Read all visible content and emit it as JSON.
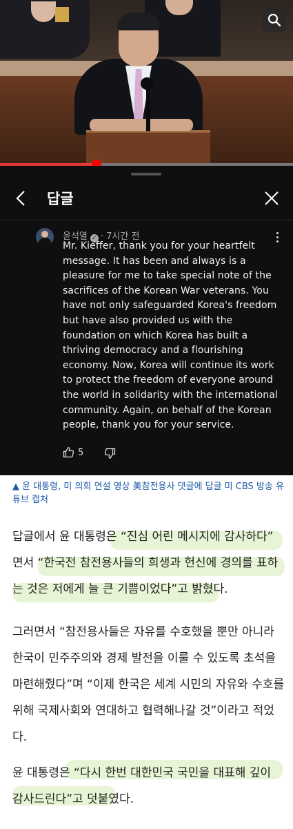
{
  "video": {
    "search_icon": "search-icon",
    "progress_percent": 33
  },
  "panel": {
    "title": "답글",
    "back_icon": "chevron-left-icon",
    "close_icon": "close-icon"
  },
  "comment": {
    "author": "윤석열",
    "verified_icon": "verified-check-icon",
    "time": "· 7시간 전",
    "text": "Mr. Kieffer, thank you for your heartfelt message. It has been and always is a pleasure for me to take special note of the sacrifices of the Korean War veterans. You have not only safeguarded Korea's freedom but have also provided us with the foundation on which Korea has built a thriving democracy and a flourishing economy. Now, Korea will continue its work to protect the freedom of everyone around the world in solidarity with the international community. Again, on behalf of the Korean people, thank you for your service.",
    "likes": "5"
  },
  "caption": "▲ 윤 대통령, 미 의회 연설 영상 美참전용사 댓글에 답글 미 CBS 방송 유튜브 캡처",
  "article": {
    "p1": "답글에서 윤 대통령은 “진심 어린 메시지에 감사하다” 면서 “한국전 참전용사들의 희생과 헌신에 경의를 표하는 것은 저에게 늘 큰 기쁨이었다”고 밝혔다.",
    "p2": "그러면서 “참전용사들은 자유를 수호했을 뿐만 아니라 한국이 민주주의와 경제 발전을 이룰 수 있도록 초석을 마련해줬다”며 “이제 한국은 세계 시민의 자유와 수호를 위해 국제사회와 연대하고 협력해나갈 것”이라고 적었다.",
    "p3": "윤 대통령은 “다시 한번 대한민국 국민을 대표해 깊이 감사드린다”고 덧붙였다."
  }
}
